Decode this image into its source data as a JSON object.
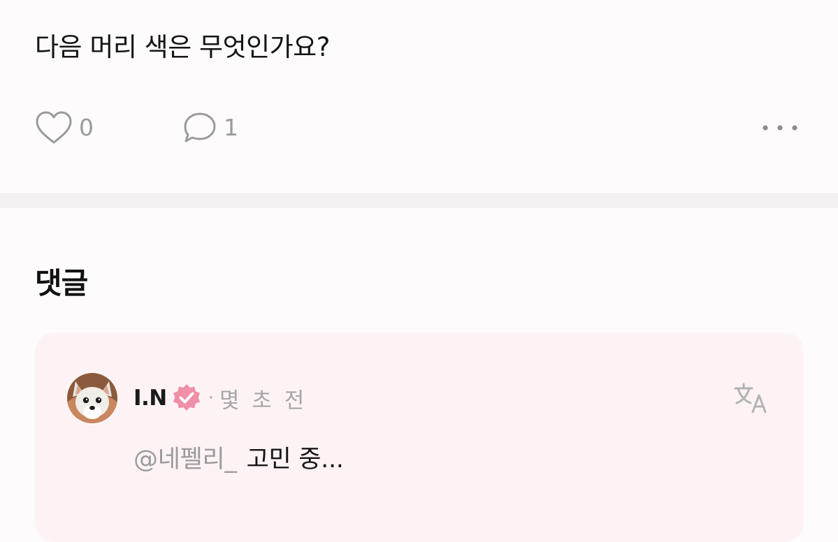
{
  "post": {
    "text": "다음 머리 색은 무엇인가요?",
    "likes": "0",
    "comments": "1"
  },
  "comments_section": {
    "heading": "댓글",
    "items": [
      {
        "author": "I.N",
        "separator": "·",
        "time": "몇 초 전",
        "mention": "@네펠리_",
        "text": "고민 중..."
      }
    ]
  },
  "icons": {
    "like": "heart-outline-icon",
    "comment": "speech-bubble-icon",
    "more": "more-dots-icon",
    "verified": "verified-badge-icon",
    "translate": "translate-icon"
  },
  "colors": {
    "background": "#fdfbfb",
    "comment_card": "#fdf3f5",
    "verified_badge": "#f08fa8",
    "muted": "#9a9a9a"
  }
}
